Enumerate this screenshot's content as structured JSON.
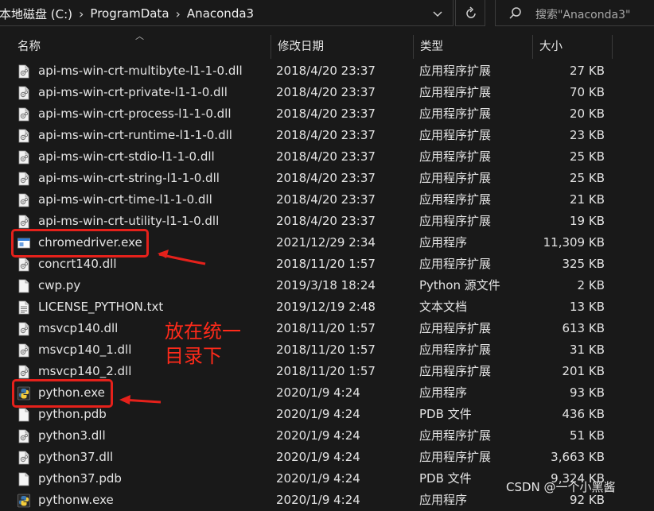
{
  "address": {
    "crumbs": [
      "本地磁盘 (C:)",
      "ProgramData",
      "Anaconda3"
    ],
    "search_placeholder": "搜索\"Anaconda3\""
  },
  "columns": {
    "name": "名称",
    "date": "修改日期",
    "type": "类型",
    "size": "大小"
  },
  "files": [
    {
      "icon": "dll-file-icon",
      "name": "api-ms-win-crt-multibyte-l1-1-0.dll",
      "date": "2018/4/20 23:37",
      "type": "应用程序扩展",
      "size": "27 KB"
    },
    {
      "icon": "dll-file-icon",
      "name": "api-ms-win-crt-private-l1-1-0.dll",
      "date": "2018/4/20 23:37",
      "type": "应用程序扩展",
      "size": "70 KB"
    },
    {
      "icon": "dll-file-icon",
      "name": "api-ms-win-crt-process-l1-1-0.dll",
      "date": "2018/4/20 23:37",
      "type": "应用程序扩展",
      "size": "20 KB"
    },
    {
      "icon": "dll-file-icon",
      "name": "api-ms-win-crt-runtime-l1-1-0.dll",
      "date": "2018/4/20 23:37",
      "type": "应用程序扩展",
      "size": "23 KB"
    },
    {
      "icon": "dll-file-icon",
      "name": "api-ms-win-crt-stdio-l1-1-0.dll",
      "date": "2018/4/20 23:37",
      "type": "应用程序扩展",
      "size": "25 KB"
    },
    {
      "icon": "dll-file-icon",
      "name": "api-ms-win-crt-string-l1-1-0.dll",
      "date": "2018/4/20 23:37",
      "type": "应用程序扩展",
      "size": "25 KB"
    },
    {
      "icon": "dll-file-icon",
      "name": "api-ms-win-crt-time-l1-1-0.dll",
      "date": "2018/4/20 23:37",
      "type": "应用程序扩展",
      "size": "21 KB"
    },
    {
      "icon": "dll-file-icon",
      "name": "api-ms-win-crt-utility-l1-1-0.dll",
      "date": "2018/4/20 23:37",
      "type": "应用程序扩展",
      "size": "19 KB"
    },
    {
      "icon": "exe-window-icon",
      "name": "chromedriver.exe",
      "date": "2021/12/29 2:34",
      "type": "应用程序",
      "size": "11,309 KB"
    },
    {
      "icon": "dll-file-icon",
      "name": "concrt140.dll",
      "date": "2018/11/20 1:57",
      "type": "应用程序扩展",
      "size": "325 KB"
    },
    {
      "icon": "blank-file-icon",
      "name": "cwp.py",
      "date": "2019/3/18 18:24",
      "type": "Python 源文件",
      "size": "2 KB"
    },
    {
      "icon": "text-file-icon",
      "name": "LICENSE_PYTHON.txt",
      "date": "2019/12/19 2:48",
      "type": "文本文档",
      "size": "13 KB"
    },
    {
      "icon": "dll-file-icon",
      "name": "msvcp140.dll",
      "date": "2018/11/20 1:57",
      "type": "应用程序扩展",
      "size": "613 KB"
    },
    {
      "icon": "dll-file-icon",
      "name": "msvcp140_1.dll",
      "date": "2018/11/20 1:57",
      "type": "应用程序扩展",
      "size": "31 KB"
    },
    {
      "icon": "dll-file-icon",
      "name": "msvcp140_2.dll",
      "date": "2018/11/20 1:57",
      "type": "应用程序扩展",
      "size": "201 KB"
    },
    {
      "icon": "python-logo-icon",
      "name": "python.exe",
      "date": "2020/1/9 4:24",
      "type": "应用程序",
      "size": "93 KB"
    },
    {
      "icon": "blank-file-icon",
      "name": "python.pdb",
      "date": "2020/1/9 4:24",
      "type": "PDB 文件",
      "size": "436 KB"
    },
    {
      "icon": "dll-file-icon",
      "name": "python3.dll",
      "date": "2020/1/9 4:24",
      "type": "应用程序扩展",
      "size": "51 KB"
    },
    {
      "icon": "dll-file-icon",
      "name": "python37.dll",
      "date": "2020/1/9 4:24",
      "type": "应用程序扩展",
      "size": "3,663 KB"
    },
    {
      "icon": "blank-file-icon",
      "name": "python37.pdb",
      "date": "2020/1/9 4:24",
      "type": "PDB 文件",
      "size": "9,324 KB"
    },
    {
      "icon": "python-logo-icon",
      "name": "pythonw.exe",
      "date": "2020/1/9 4:24",
      "type": "应用程序",
      "size": "92 KB"
    }
  ],
  "annotation": {
    "note_line1": "放在统一",
    "note_line2": "目录下",
    "color": "#e5211b"
  },
  "watermark": "CSDN @一个小黑酱"
}
